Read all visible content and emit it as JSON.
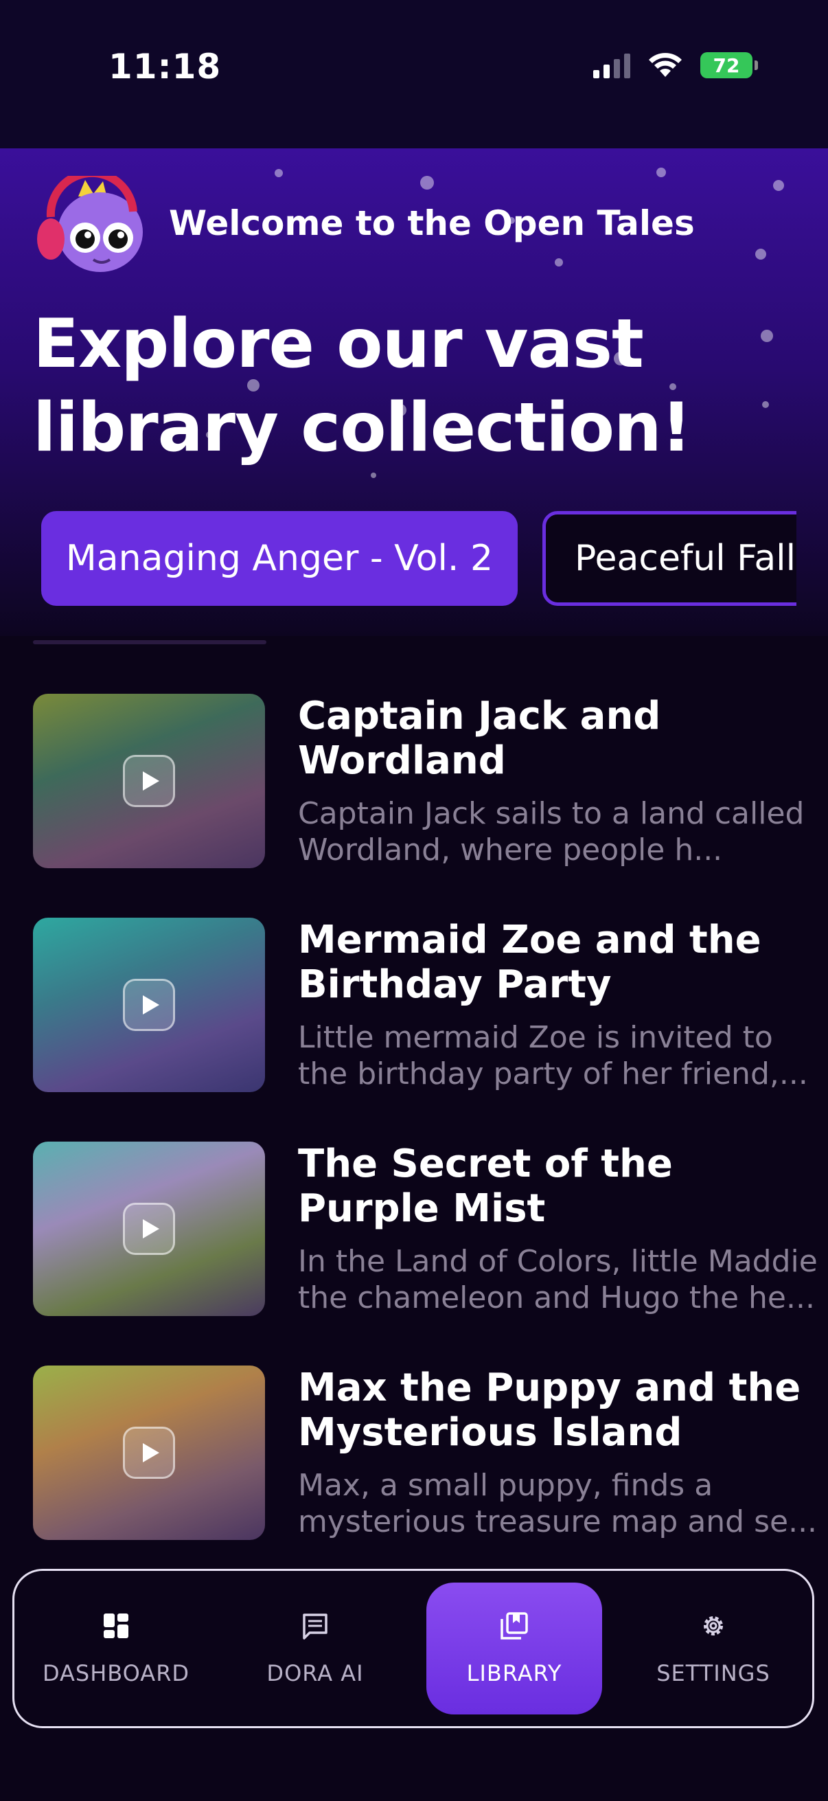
{
  "status_bar": {
    "time": "11:18",
    "battery": "72"
  },
  "hero": {
    "welcome": "Welcome to the Open Tales",
    "headline": "Explore our vast library collection!"
  },
  "categories": [
    {
      "label": "Managing Anger - Vol. 2",
      "selected": true
    },
    {
      "label": "Peaceful Falli",
      "selected": false
    }
  ],
  "stories": [
    {
      "title": "Captain Jack and Wordland",
      "description": "Captain Jack sails to a land called Wordland, where people h..."
    },
    {
      "title": "Mermaid Zoe and the Birthday Party",
      "description": "Little mermaid Zoe is invited to the birthday party of her friend,..."
    },
    {
      "title": "The Secret of the Purple Mist",
      "description": "In the Land of Colors, little Maddie the chameleon and Hugo the he..."
    },
    {
      "title": "Max the Puppy and the Mysterious Island",
      "description": "Max, a small puppy, finds a mysterious treasure map and se..."
    }
  ],
  "nav": {
    "dashboard": "DASHBOARD",
    "dora_ai": "DORA AI",
    "library": "LIBRARY",
    "settings": "SETTINGS",
    "active": "library"
  },
  "colors": {
    "accent": "#6a2ee0",
    "background": "#0b0418",
    "hero_top": "#3a0f9a",
    "muted_text": "#8a8196"
  }
}
